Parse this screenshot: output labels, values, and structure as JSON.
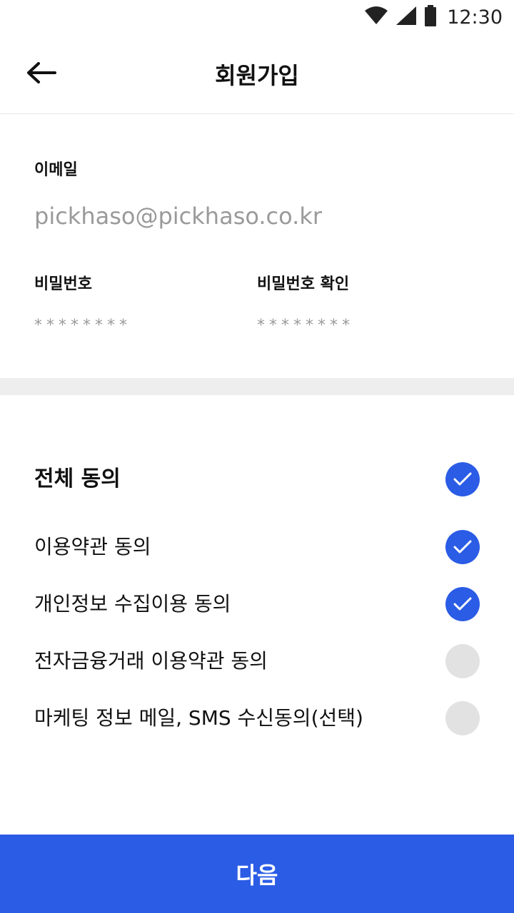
{
  "status": {
    "time": "12:30",
    "icons": [
      "wifi-icon",
      "signal-icon",
      "battery-icon"
    ]
  },
  "header": {
    "title": "회원가입",
    "back_icon": "arrow-left-icon"
  },
  "form": {
    "email_label": "이메일",
    "email_value": "pickhaso@pickhaso.co.kr",
    "password_label": "비밀번호",
    "password_value": "********",
    "password_confirm_label": "비밀번호 확인",
    "password_confirm_value": "********"
  },
  "agreements": [
    {
      "label": "전체 동의",
      "checked": true
    },
    {
      "label": "이용약관 동의",
      "checked": true
    },
    {
      "label": "개인정보 수집이용 동의",
      "checked": true
    },
    {
      "label": "전자금융거래 이용약관 동의",
      "checked": false
    },
    {
      "label": "마케팅 정보 메일, SMS 수신동의(선택)",
      "checked": false
    }
  ],
  "next_button": {
    "label": "다음"
  },
  "colors": {
    "accent": "#2b5ce6",
    "unchecked": "#e2e2e2",
    "placeholder": "#9a9a9a",
    "band": "#eeeeee"
  }
}
